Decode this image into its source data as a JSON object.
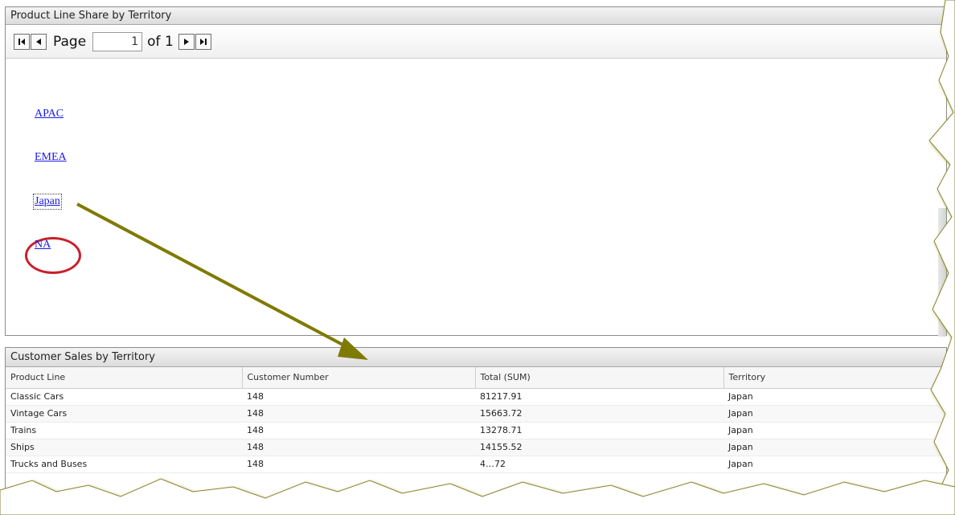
{
  "top_panel": {
    "title": "Product Line Share by Territory",
    "pager": {
      "page_label": "Page",
      "page_value": "1",
      "of_label": "of 1"
    },
    "territories": [
      "APAC",
      "EMEA",
      "Japan",
      "NA"
    ],
    "selected_territory": "Japan"
  },
  "bottom_panel": {
    "title": "Customer Sales by Territory",
    "columns": [
      "Product Line",
      "Customer Number",
      "Total (SUM)",
      "Territory"
    ],
    "rows": [
      [
        "Classic Cars",
        "148",
        "81217.91",
        "Japan"
      ],
      [
        "Vintage Cars",
        "148",
        "15663.72",
        "Japan"
      ],
      [
        "Trains",
        "148",
        "13278.71",
        "Japan"
      ],
      [
        "Ships",
        "148",
        "14155.52",
        "Japan"
      ],
      [
        "Trucks and Buses",
        "148",
        "4…72",
        "Japan"
      ]
    ]
  },
  "colors": {
    "link": "#1a1ae6",
    "highlight_ring": "#c8202b",
    "arrow": "#7f7a00",
    "torn_edge_shadow": "#a59d2e"
  },
  "icons": [
    "first-page-icon",
    "previous-page-icon",
    "next-page-icon",
    "last-page-icon"
  ]
}
